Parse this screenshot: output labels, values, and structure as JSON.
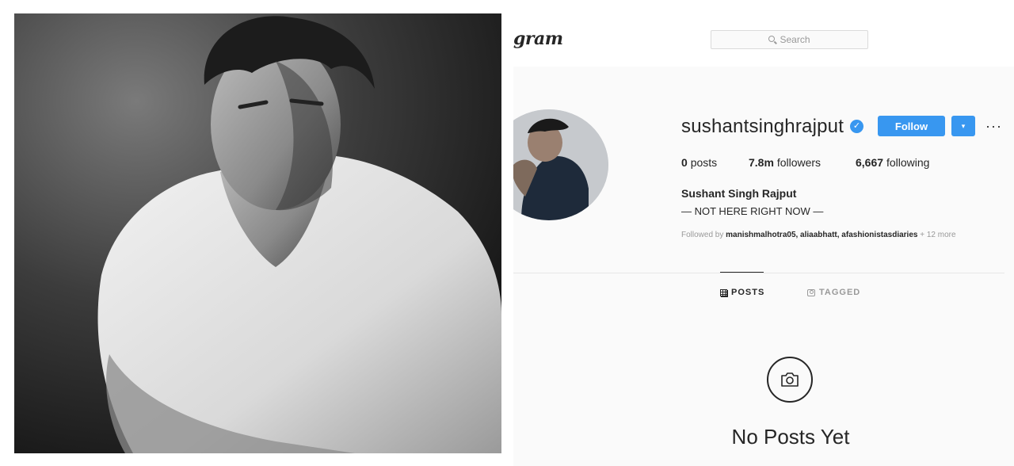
{
  "header": {
    "logo_text": "gram",
    "search_placeholder": "Search"
  },
  "profile": {
    "username": "sushantsinghrajput",
    "verified_icon": "verified-badge-icon",
    "follow_label": "Follow",
    "dropdown_icon": "▾",
    "more_icon": "···",
    "stats": {
      "posts_count": "0",
      "posts_label": "posts",
      "followers_count": "7.8m",
      "followers_label": "followers",
      "following_count": "6,667",
      "following_label": "following"
    },
    "full_name": "Sushant Singh Rajput",
    "bio": "— NOT HERE RIGHT NOW —",
    "followed_by_prefix": "Followed by",
    "followed_by_users": "manishmalhotra05, aliaabhatt, afashionistasdiaries",
    "followed_by_more": "+ 12 more"
  },
  "tabs": [
    {
      "label": "POSTS",
      "icon": "grid-icon",
      "active": true
    },
    {
      "label": "TAGGED",
      "icon": "tagged-icon",
      "active": false
    }
  ],
  "empty_state": {
    "icon": "camera-icon",
    "message": "No Posts Yet"
  },
  "colors": {
    "accent": "#3897f0",
    "text": "#262626",
    "muted": "#999999",
    "panel_bg": "#fafafa"
  }
}
